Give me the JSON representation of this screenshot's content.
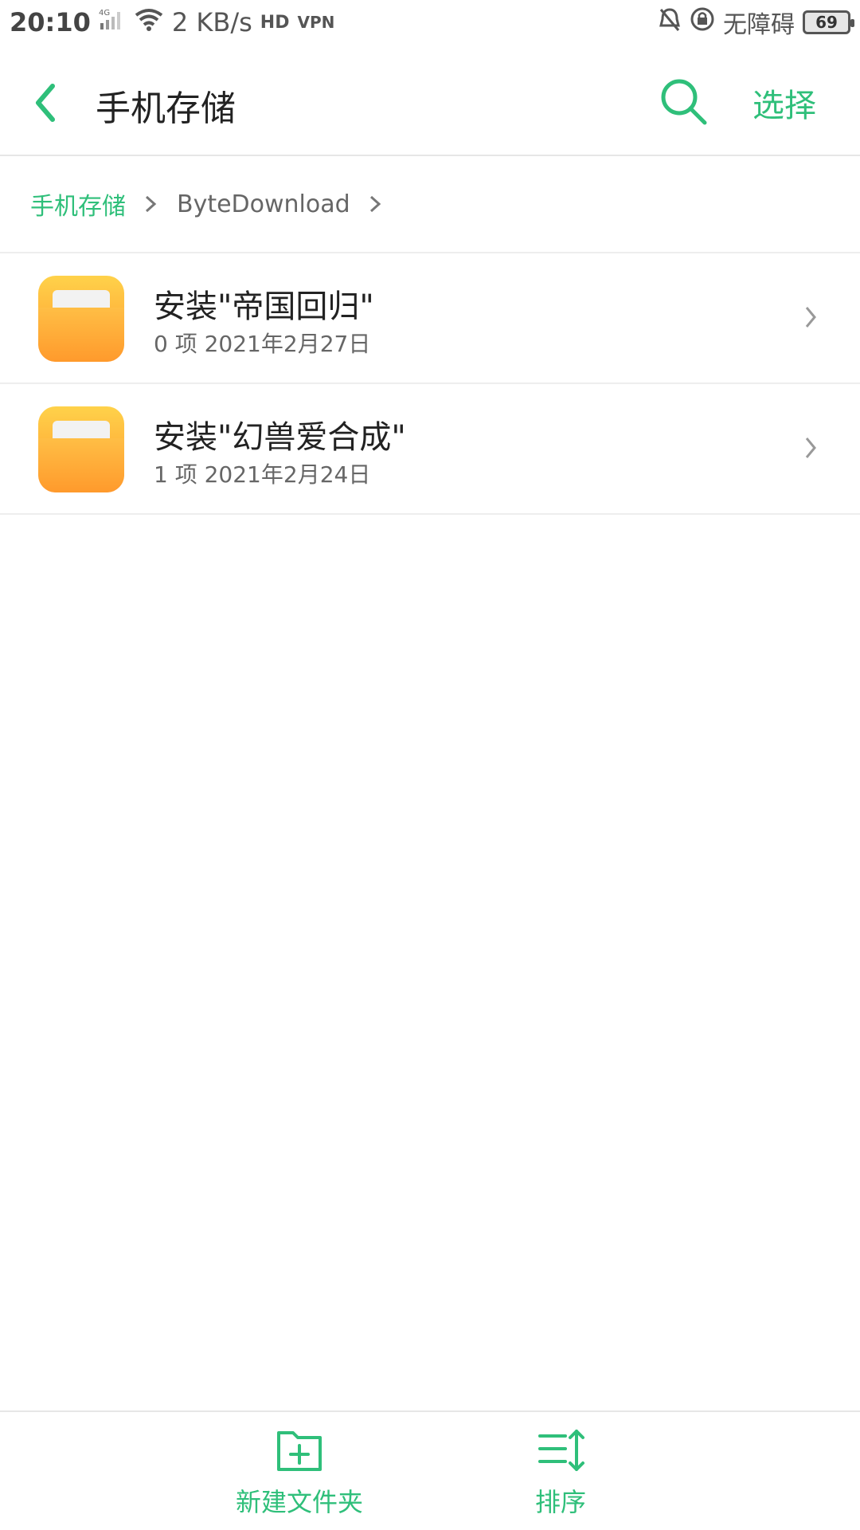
{
  "status_bar": {
    "time": "20:10",
    "network": "4G",
    "speed": "2 KB/s",
    "hd_label": "HD",
    "vpn_label": "VPN",
    "accessibility_text": "无障碍",
    "battery": "69"
  },
  "header": {
    "title": "手机存储",
    "select_label": "选择"
  },
  "breadcrumb": {
    "items": [
      "手机存储",
      "ByteDownload"
    ]
  },
  "files": [
    {
      "name": "安装\"帝国回归\"",
      "meta": "0 项  2021年2月27日"
    },
    {
      "name": "安装\"幻兽爱合成\"",
      "meta": "1 项  2021年2月24日"
    }
  ],
  "bottom_bar": {
    "new_folder_label": "新建文件夹",
    "sort_label": "排序"
  },
  "colors": {
    "accent": "#2fbf7a",
    "folder": "#ffb13a"
  }
}
